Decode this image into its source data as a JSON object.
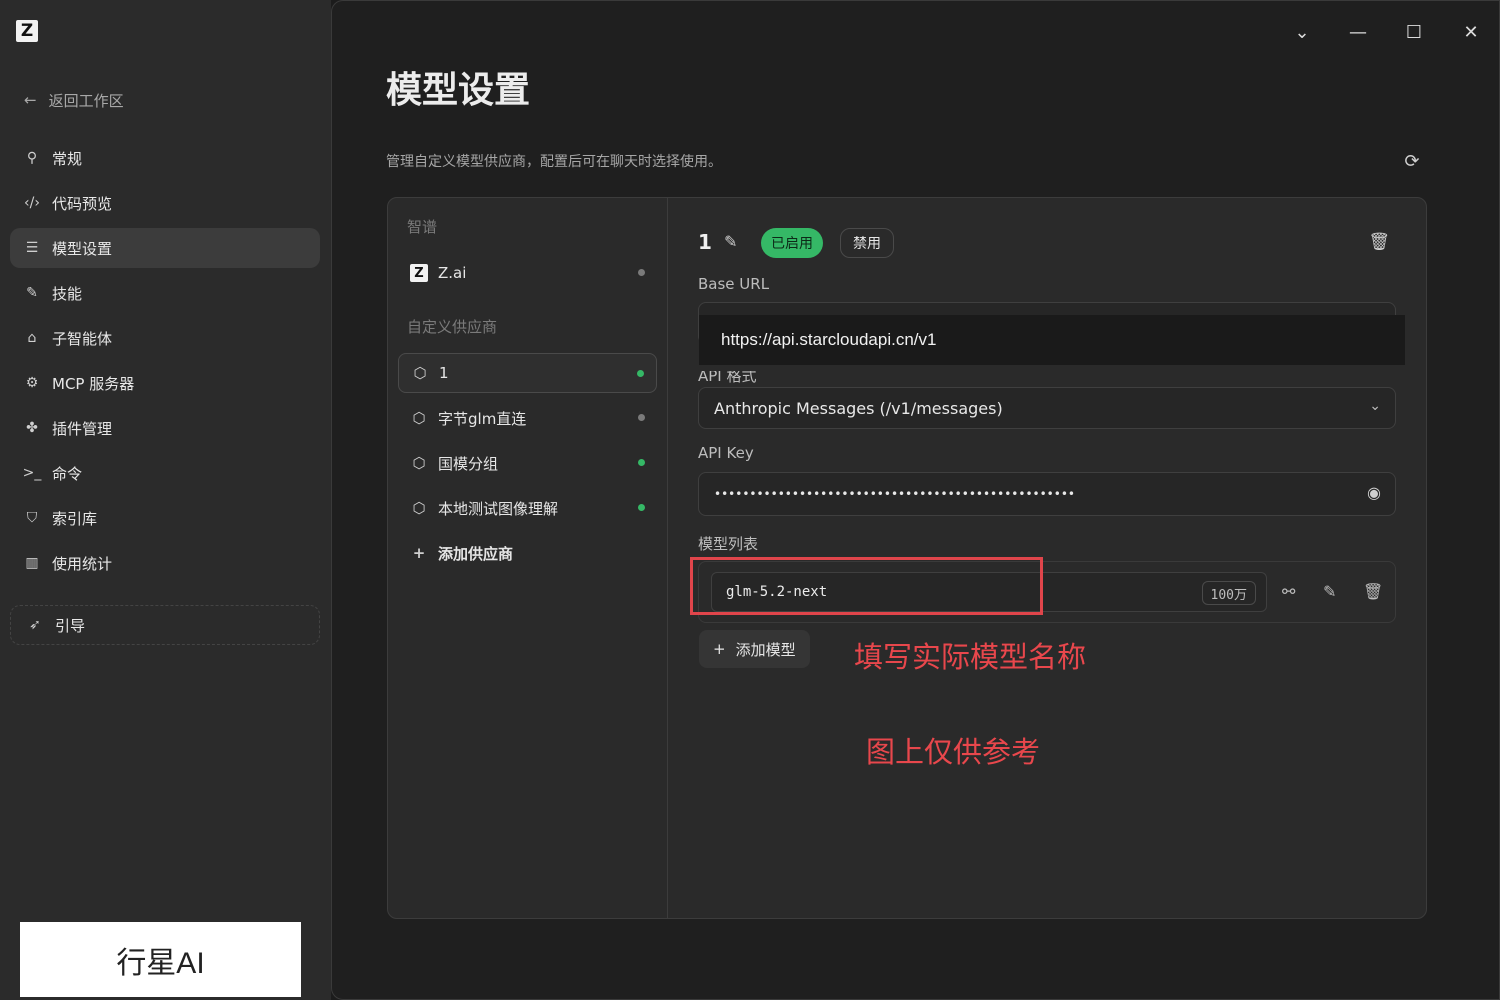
{
  "sidebar": {
    "back_label": "返回工作区",
    "nav": [
      {
        "label": "常规",
        "icon": "sliders-icon",
        "glyph": "⚲"
      },
      {
        "label": "代码预览",
        "icon": "code-icon",
        "glyph": "‹/›"
      },
      {
        "label": "模型设置",
        "icon": "model-settings-icon",
        "glyph": "☰",
        "active": true
      },
      {
        "label": "技能",
        "icon": "magic-wand-icon",
        "glyph": "✎"
      },
      {
        "label": "子智能体",
        "icon": "robot-icon",
        "glyph": "⌂"
      },
      {
        "label": "MCP 服务器",
        "icon": "mcp-icon",
        "glyph": "⚙"
      },
      {
        "label": "插件管理",
        "icon": "puzzle-icon",
        "glyph": "✤"
      },
      {
        "label": "命令",
        "icon": "terminal-icon",
        "glyph": ">_"
      },
      {
        "label": "索引库",
        "icon": "shield-icon",
        "glyph": "⛉"
      },
      {
        "label": "使用统计",
        "icon": "bar-chart-icon",
        "glyph": "▥"
      }
    ],
    "guide_label": "引导",
    "brand": "行星AI"
  },
  "main": {
    "title": "模型设置",
    "description": "管理自定义模型供应商，配置后可在聊天时选择使用。"
  },
  "providers": {
    "group1_label": "智谱",
    "zai": {
      "name": "Z.ai",
      "badge": "Z"
    },
    "group2_label": "自定义供应商",
    "custom": [
      {
        "name": "1",
        "status": "enabled"
      },
      {
        "name": "字节glm直连",
        "status": "disabled"
      },
      {
        "name": "国模分组",
        "status": "enabled"
      },
      {
        "name": "本地测试图像理解",
        "status": "enabled"
      }
    ],
    "add_label": "添加供应商"
  },
  "detail": {
    "name": "1",
    "enabled_label": "已启用",
    "disable_label": "禁用",
    "base_url_label": "Base URL",
    "base_url_value": "https://api.starcloudapi.cn/v1",
    "api_format_label": "API 格式",
    "api_format_value": "Anthropic Messages (/v1/messages)",
    "api_key_label": "API Key",
    "api_key_value": "•••••••••••••••••••••••••••••••••••••••••••••••••••",
    "models_label": "模型列表",
    "model_name": "glm-5.2-next",
    "model_context": "100万",
    "add_model_label": "添加模型"
  },
  "annotations": {
    "fill_hint": "填写实际模型名称",
    "reference_note": "图上仅供参考"
  },
  "colors": {
    "enabled": "#35b866",
    "disabled": "#7a7a7a",
    "annotation": "#e8474c"
  }
}
